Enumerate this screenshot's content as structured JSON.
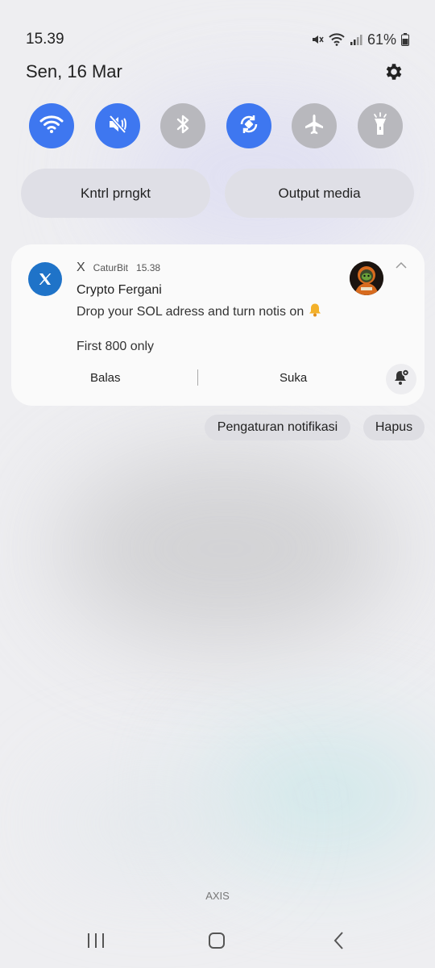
{
  "status_bar": {
    "time": "15.39",
    "battery": "61%",
    "icons": [
      "mute-icon",
      "wifi-icon",
      "signal-icon",
      "battery-icon"
    ]
  },
  "header": {
    "date": "Sen, 16 Mar",
    "settings_icon": "gear-icon"
  },
  "quick_settings": {
    "toggles": [
      {
        "name": "wifi",
        "icon": "wifi-icon",
        "state": "on"
      },
      {
        "name": "sound",
        "icon": "mute-icon",
        "state": "on"
      },
      {
        "name": "bluetooth",
        "icon": "bluetooth-icon",
        "state": "off"
      },
      {
        "name": "auto-rotate",
        "icon": "rotate-icon",
        "state": "on"
      },
      {
        "name": "airplane",
        "icon": "airplane-icon",
        "state": "off"
      },
      {
        "name": "flashlight",
        "icon": "flashlight-icon",
        "state": "off"
      }
    ],
    "device_control_label": "Kntrl prngkt",
    "media_output_label": "Output media"
  },
  "notification": {
    "app": "X",
    "account": "CaturBit",
    "time": "15.38",
    "sender": "Crypto Fergani",
    "line1": "Drop your SOL adress and turn notis on",
    "line2": "First 800 only",
    "reply_label": "Balas",
    "like_label": "Suka"
  },
  "notification_actions": {
    "settings_label": "Pengaturan notifikasi",
    "clear_label": "Hapus"
  },
  "carrier": "AXIS",
  "colors": {
    "accent": "#3e77f0",
    "toggle_off": "#b8b8bd",
    "x_badge": "#1f73c8"
  }
}
